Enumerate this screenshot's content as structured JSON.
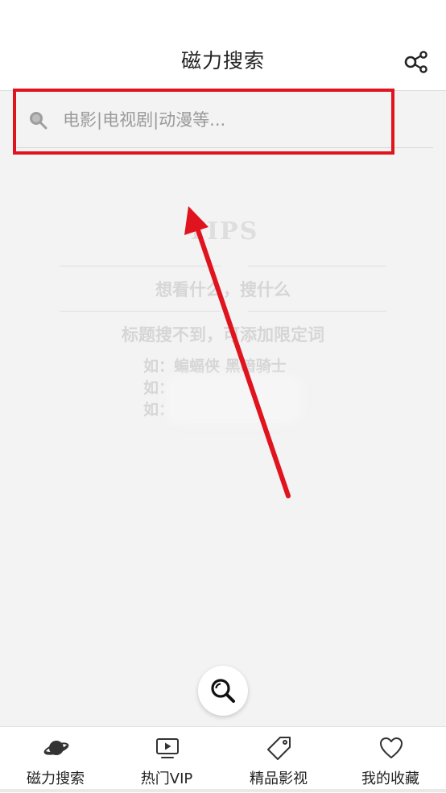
{
  "header": {
    "title": "磁力搜索",
    "share_icon": "share-icon"
  },
  "search": {
    "placeholder": "电影|电视剧|动漫等...",
    "value": "",
    "icon": "search-icon",
    "highlight_color": "#e0141e"
  },
  "tips": {
    "heading": "TIPS",
    "line1": "想看什么，搜什么",
    "line2": "标题搜不到，可添加限定词",
    "example1_prefix": "如：",
    "example1_text": "蝙蝠侠 黑暗骑士",
    "example2_prefix": "如：",
    "example3_prefix": "如："
  },
  "fab": {
    "icon": "magnifier-icon"
  },
  "tabbar": {
    "items": [
      {
        "label": "磁力搜索",
        "icon": "planet-icon",
        "active": true
      },
      {
        "label": "热门VIP",
        "icon": "tv-play-icon",
        "active": false
      },
      {
        "label": "精品影视",
        "icon": "tag-icon",
        "active": false
      },
      {
        "label": "我的收藏",
        "icon": "heart-icon",
        "active": false
      }
    ]
  },
  "colors": {
    "accent_red": "#e0141e",
    "background": "#f3f3f3",
    "bar": "#ffffff"
  }
}
